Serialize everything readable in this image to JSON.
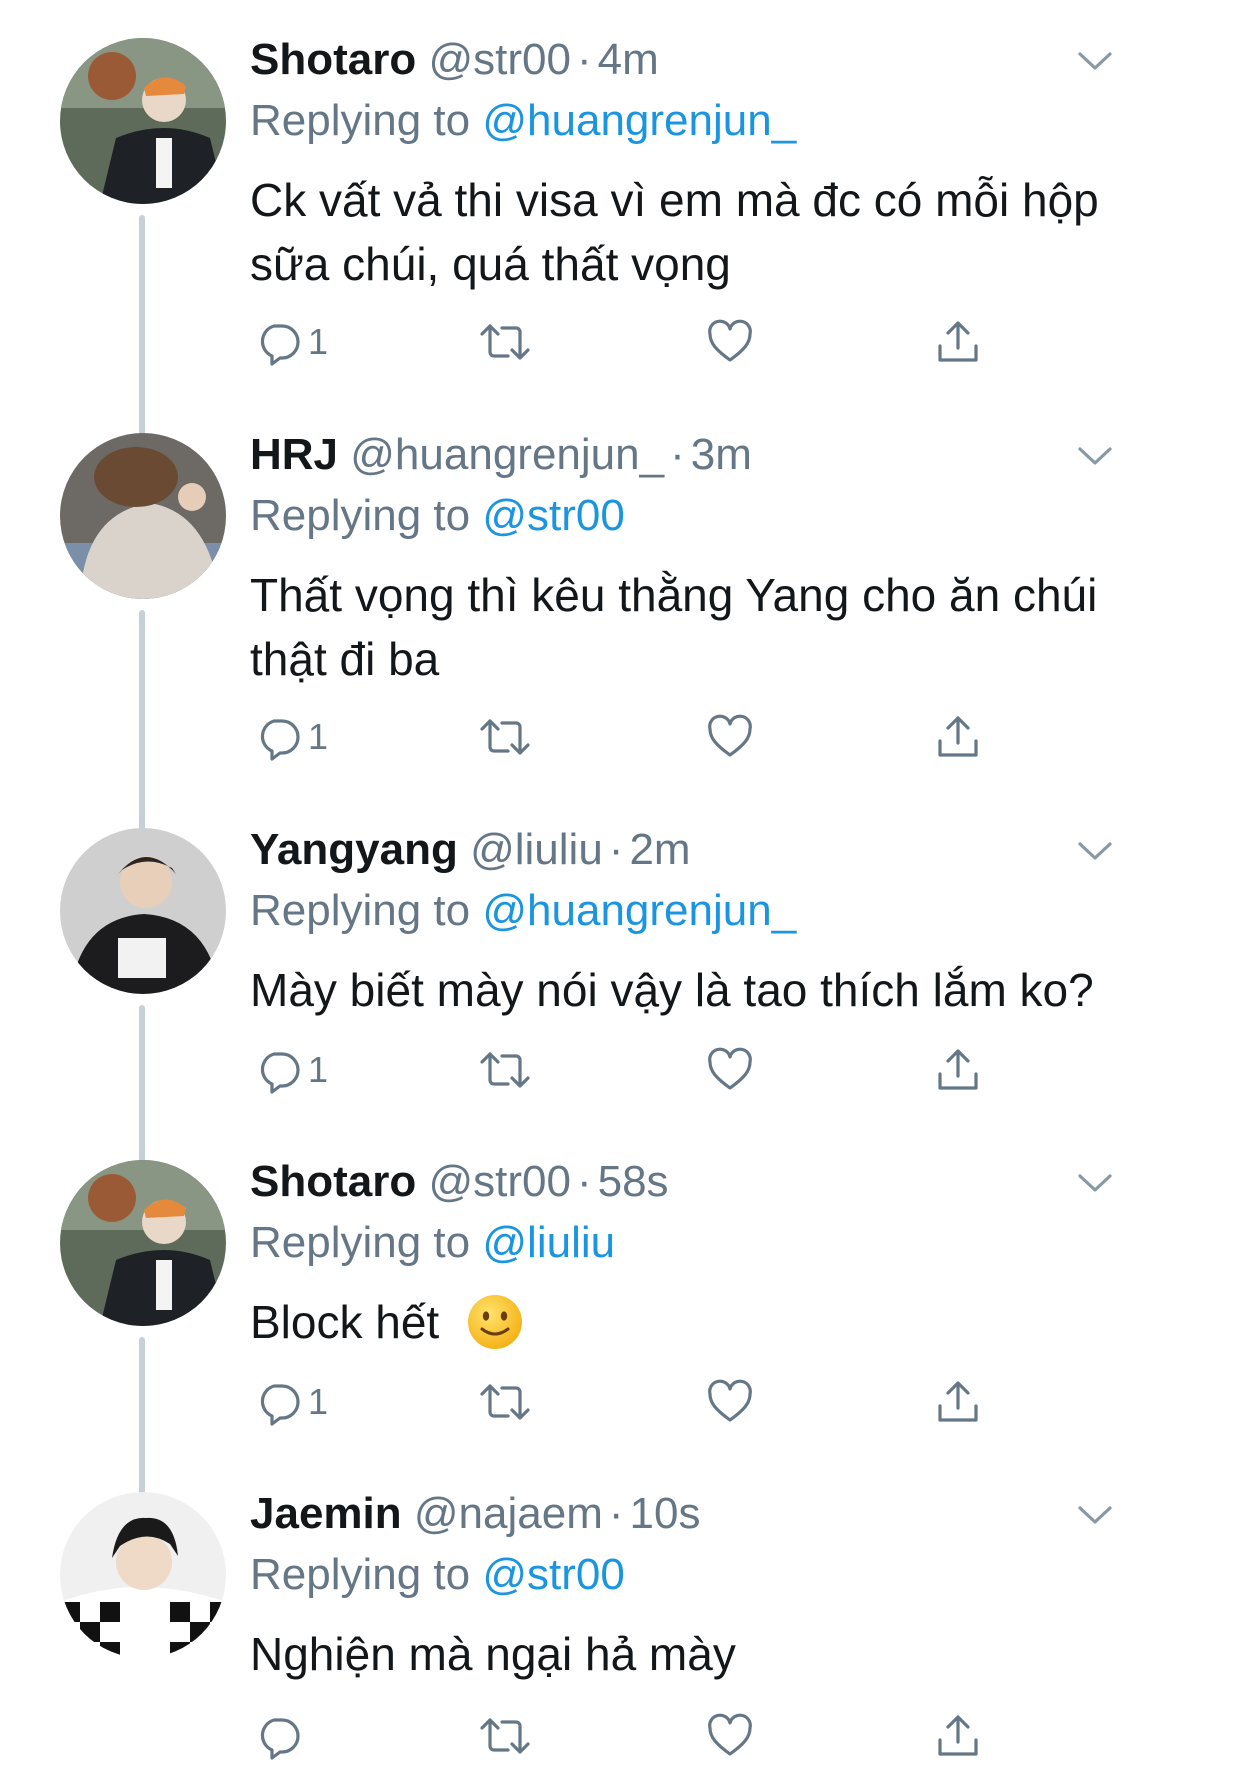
{
  "colors": {
    "text": "#14171a",
    "muted": "#657786",
    "link": "#1b95e0",
    "thread_line": "#c6d0d8"
  },
  "replying_label": "Replying to",
  "tweets": [
    {
      "name": "Shotaro",
      "handle": "@str00",
      "time": "4m",
      "reply_to": "@huangrenjun_",
      "text": "Ck vất vả thi visa vì em mà đc có mỗi hộp sữa chúi, quá thất vọng",
      "reply_count": "1",
      "avatar_icon": "avatar-photo"
    },
    {
      "name": "HRJ",
      "handle": "@huangrenjun_",
      "time": "3m",
      "reply_to": "@str00",
      "text": "Thất vọng thì kêu thằng Yang cho ăn chúi thật đi ba",
      "reply_count": "1",
      "avatar_icon": "avatar-photo"
    },
    {
      "name": "Yangyang",
      "handle": "@liuliu",
      "time": "2m",
      "reply_to": "@huangrenjun_",
      "text": "Mày biết mày nói vậy là tao thích lắm ko?",
      "reply_count": "1",
      "avatar_icon": "avatar-photo"
    },
    {
      "name": "Shotaro",
      "handle": "@str00",
      "time": "58s",
      "reply_to": "@liuliu",
      "text": "Block hết",
      "reply_count": "1",
      "emoji": "slightly-smiling-face",
      "avatar_icon": "avatar-photo"
    },
    {
      "name": "Jaemin",
      "handle": "@najaem",
      "time": "10s",
      "reply_to": "@str00",
      "text": "Nghiện mà ngại hả mày",
      "reply_count": "",
      "avatar_icon": "avatar-photo"
    }
  ],
  "icons": {
    "reply": "reply-icon",
    "retweet": "retweet-icon",
    "like": "heart-icon",
    "share": "share-icon",
    "more": "chevron-down-icon"
  }
}
